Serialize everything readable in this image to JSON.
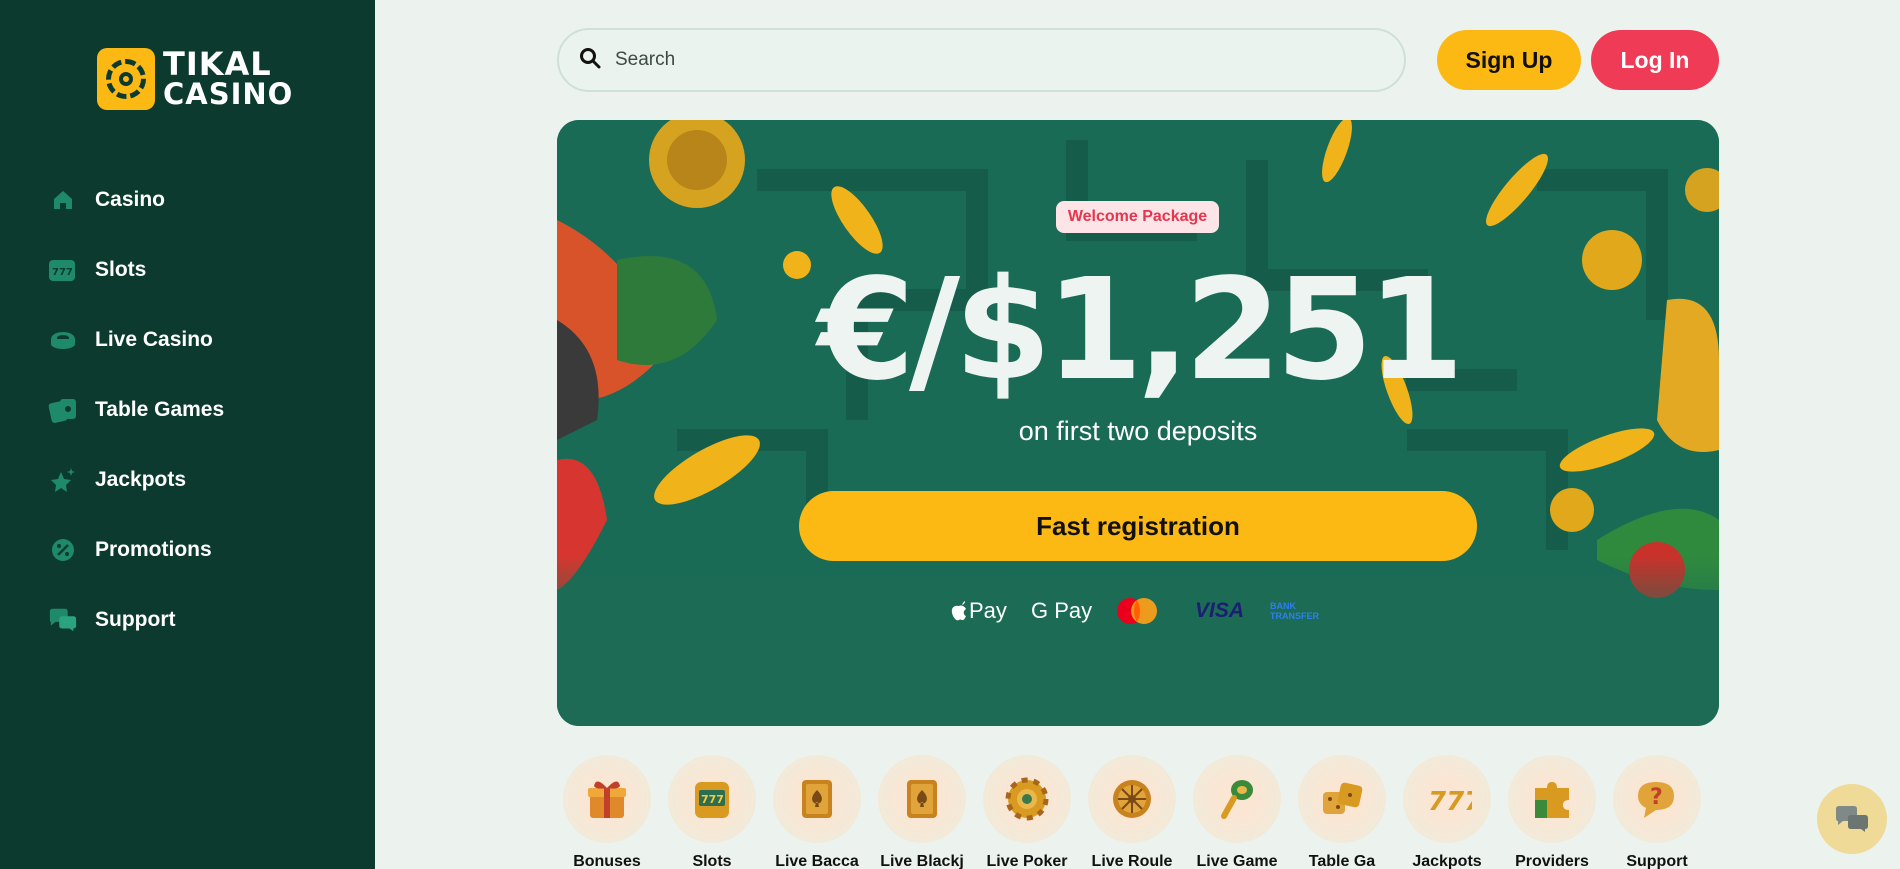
{
  "brand": {
    "line1": "TIKAL",
    "line2": "CASINO"
  },
  "nav": [
    {
      "label": "Casino",
      "icon": "home-icon"
    },
    {
      "label": "Slots",
      "icon": "slot-machine-icon"
    },
    {
      "label": "Live Casino",
      "icon": "chip-icon"
    },
    {
      "label": "Table Games",
      "icon": "cards-icon"
    },
    {
      "label": "Jackpots",
      "icon": "star-icon"
    },
    {
      "label": "Promotions",
      "icon": "percent-badge-icon"
    },
    {
      "label": "Support",
      "icon": "chat-icon"
    }
  ],
  "search": {
    "placeholder": "Search"
  },
  "header": {
    "signup": "Sign Up",
    "login": "Log In"
  },
  "hero": {
    "badge": "Welcome Package",
    "amount": "€/$1,251",
    "subtitle": "on first two deposits",
    "cta": "Fast registration",
    "payments": [
      "Pay",
      "G Pay",
      "mastercard",
      "VISA",
      "BANK TRANSFER"
    ]
  },
  "categories": [
    {
      "label": "Bonuses",
      "icon": "gift-icon"
    },
    {
      "label": "Slots",
      "icon": "slot-machine-icon"
    },
    {
      "label": "Live Bacca",
      "icon": "card-spade-icon"
    },
    {
      "label": "Live Blackj",
      "icon": "card-spade-icon"
    },
    {
      "label": "Live Poker",
      "icon": "poker-chip-icon"
    },
    {
      "label": "Live Roule",
      "icon": "roulette-icon"
    },
    {
      "label": "Live Game",
      "icon": "maraca-icon"
    },
    {
      "label": "Table Ga",
      "icon": "dice-icon"
    },
    {
      "label": "Jackpots",
      "icon": "sevens-icon"
    },
    {
      "label": "Providers",
      "icon": "puzzle-icon"
    },
    {
      "label": "Support",
      "icon": "question-icon"
    }
  ],
  "colors": {
    "sidebar": "#0d3a2e",
    "accent": "#fdb913",
    "login": "#ef3b55",
    "hero": "#1a6b55",
    "page": "#ecf3ef"
  }
}
